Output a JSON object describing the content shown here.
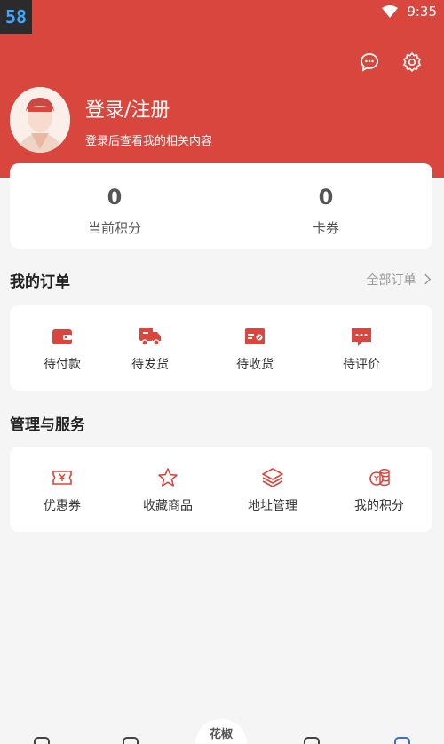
{
  "status_bar": {
    "badge": "58",
    "time": "9:35"
  },
  "profile": {
    "title": "登录/注册",
    "subtitle": "登录后查看我的相关内容"
  },
  "stats": [
    {
      "value": "0",
      "label": "当前积分"
    },
    {
      "value": "0",
      "label": "卡券"
    }
  ],
  "orders": {
    "title": "我的订单",
    "all_label": "全部订单",
    "items": [
      {
        "label": "待付款",
        "icon": "wallet-icon"
      },
      {
        "label": "待发货",
        "icon": "truck-icon"
      },
      {
        "label": "待收货",
        "icon": "package-icon"
      },
      {
        "label": "待评价",
        "icon": "comment-icon"
      }
    ]
  },
  "services": {
    "title": "管理与服务",
    "items": [
      {
        "label": "优惠券",
        "icon": "coupon-icon"
      },
      {
        "label": "收藏商品",
        "icon": "star-icon"
      },
      {
        "label": "地址管理",
        "icon": "layers-icon"
      },
      {
        "label": "我的积分",
        "icon": "coins-icon"
      }
    ]
  },
  "tabbar": {
    "center_label": "花椒"
  },
  "colors": {
    "brand": "#d9463e",
    "background": "#f5f5f5"
  }
}
